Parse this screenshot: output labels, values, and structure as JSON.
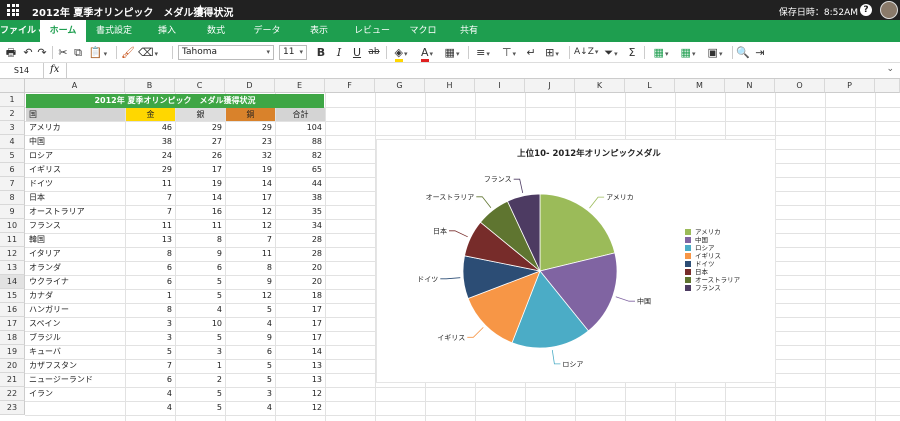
{
  "app": {
    "title": "2012年 夏季オリンピック　メダル獲得状況",
    "save_status": "保存日時：8:52AM",
    "help_label": "?"
  },
  "tabs": [
    "ファイル",
    "ホーム",
    "書式設定",
    "挿入",
    "数式",
    "データ",
    "表示",
    "レビュー",
    "マクロ",
    "共有"
  ],
  "active_tab": "ホーム",
  "toolbar": {
    "font_name": "Tahoma",
    "font_size": "11",
    "bold": "B",
    "italic": "I",
    "underline": "U",
    "strike": "ab",
    "sum": "Σ"
  },
  "formula_bar": {
    "cell_ref": "S14",
    "fx": "fx",
    "formula": ""
  },
  "columns": [
    "A",
    "B",
    "C",
    "D",
    "E",
    "F",
    "G",
    "H",
    "I",
    "J",
    "K",
    "L",
    "M",
    "N",
    "O",
    "P"
  ],
  "rows": [
    "1",
    "2",
    "3",
    "4",
    "5",
    "6",
    "7",
    "8",
    "9",
    "10",
    "11",
    "12",
    "13",
    "14",
    "15",
    "16",
    "17",
    "18",
    "19",
    "20",
    "21",
    "22",
    "23"
  ],
  "selected_row": "14",
  "sheet": {
    "banner": "2012年 夏季オリンピック　メダル獲得状況",
    "header": {
      "country": "国",
      "gold": "金",
      "silver": "銀",
      "bronze": "銅",
      "total": "合計"
    },
    "rows": [
      [
        "アメリカ",
        "46",
        "29",
        "29",
        "104"
      ],
      [
        "中国",
        "38",
        "27",
        "23",
        "88"
      ],
      [
        "ロシア",
        "24",
        "26",
        "32",
        "82"
      ],
      [
        "イギリス",
        "29",
        "17",
        "19",
        "65"
      ],
      [
        "ドイツ",
        "11",
        "19",
        "14",
        "44"
      ],
      [
        "日本",
        "7",
        "14",
        "17",
        "38"
      ],
      [
        "オーストラリア",
        "7",
        "16",
        "12",
        "35"
      ],
      [
        "フランス",
        "11",
        "11",
        "12",
        "34"
      ],
      [
        "韓国",
        "13",
        "8",
        "7",
        "28"
      ],
      [
        "イタリア",
        "8",
        "9",
        "11",
        "28"
      ],
      [
        "オランダ",
        "6",
        "6",
        "8",
        "20"
      ],
      [
        "ウクライナ",
        "6",
        "5",
        "9",
        "20"
      ],
      [
        "カナダ",
        "1",
        "5",
        "12",
        "18"
      ],
      [
        "ハンガリー",
        "8",
        "4",
        "5",
        "17"
      ],
      [
        "スペイン",
        "3",
        "10",
        "4",
        "17"
      ],
      [
        "ブラジル",
        "3",
        "5",
        "9",
        "17"
      ],
      [
        "キューバ",
        "5",
        "3",
        "6",
        "14"
      ],
      [
        "カザフスタン",
        "7",
        "1",
        "5",
        "13"
      ],
      [
        "ニュージーランド",
        "6",
        "2",
        "5",
        "13"
      ],
      [
        "イラン",
        "4",
        "5",
        "3",
        "12"
      ],
      [
        "",
        "4",
        "5",
        "4",
        "12"
      ]
    ],
    "colors": {
      "banner": "#3ea645",
      "gold": "#ffd700",
      "silver": "#dddddd",
      "bronze": "#d9822b",
      "header_grey": "#d4d4d4"
    }
  },
  "chart_data": {
    "type": "pie",
    "title": "上位10- 2012年オリンピックメダル",
    "categories": [
      "アメリカ",
      "中国",
      "ロシア",
      "イギリス",
      "ドイツ",
      "日本",
      "オーストラリア",
      "フランス"
    ],
    "values": [
      104,
      88,
      82,
      65,
      44,
      38,
      35,
      34
    ],
    "colors": [
      "#9bbb59",
      "#8064a2",
      "#4bacc6",
      "#f79646",
      "#2c4d75",
      "#772c2a",
      "#5f7530",
      "#4d3b62"
    ],
    "legend_position": "right",
    "data_labels": "category names outside with leader lines"
  }
}
